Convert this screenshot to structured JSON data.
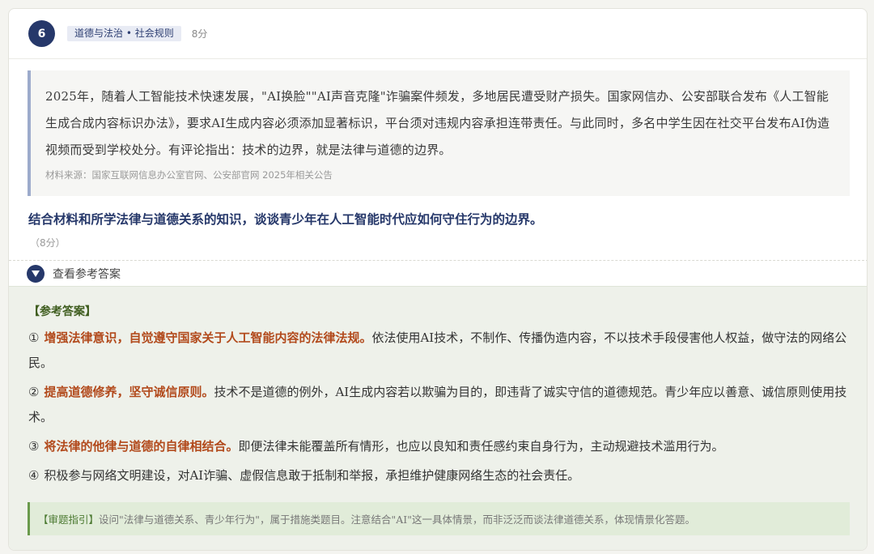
{
  "question": {
    "number": "6",
    "subject": "道德与法治 • 社会规则",
    "points": "8分",
    "material_text": "2025年，随着人工智能技术快速发展，\"AI换脸\"\"AI声音克隆\"诈骗案件频发，多地居民遭受财产损失。国家网信办、公安部联合发布《人工智能生成合成内容标识办法》，要求AI生成内容必须添加显著标识，平台须对违规内容承担连带责任。与此同时，多名中学生因在社交平台发布AI伪造视频而受到学校处分。有评论指出：技术的边界，就是法律与道德的边界。",
    "material_source": "材料来源：国家互联网信息办公室官网、公安部官网 2025年相关公告",
    "prompt": "结合材料和所学法律与道德关系的知识，谈谈青少年在人工智能时代应如何守住行为的边界。",
    "prompt_points": "（8分）"
  },
  "toggle": {
    "label": "查看参考答案",
    "icon": "chevron-down-icon"
  },
  "answer": {
    "heading": "【参考答案】",
    "items": [
      {
        "index": "①",
        "key": "增强法律意识，自觉遵守国家关于人工智能内容的法律法规。",
        "text": "依法使用AI技术，不制作、传播伪造内容，不以技术手段侵害他人权益，做守法的网络公民。"
      },
      {
        "index": "②",
        "key": "提高道德修养，坚守诚信原则。",
        "text": "技术不是道德的例外，AI生成内容若以欺骗为目的，即违背了诚实守信的道德规范。青少年应以善意、诚信原则使用技术。"
      },
      {
        "index": "③",
        "key": "将法律的他律与道德的自律相结合。",
        "text": "即便法律未能覆盖所有情形，也应以良知和责任感约束自身行为，主动规避技术滥用行为。"
      },
      {
        "index": "④",
        "key": "",
        "text": "积极参与网络文明建设，对AI诈骗、虚假信息敢于抵制和举报，承担维护健康网络生态的社会责任。"
      }
    ],
    "tip_label": "【审题指引】",
    "tip_text": "设问\"法律与道德关系、青少年行为\"，属于措施类题目。注意结合\"AI\"这一具体情景，而非泛泛而谈法律道德关系，体现情景化答题。"
  },
  "colors": {
    "accent_navy": "#26386a",
    "key_point": "#b24a1c",
    "answer_bg": "#eef1ea",
    "tip_green": "#6a9a4c"
  }
}
